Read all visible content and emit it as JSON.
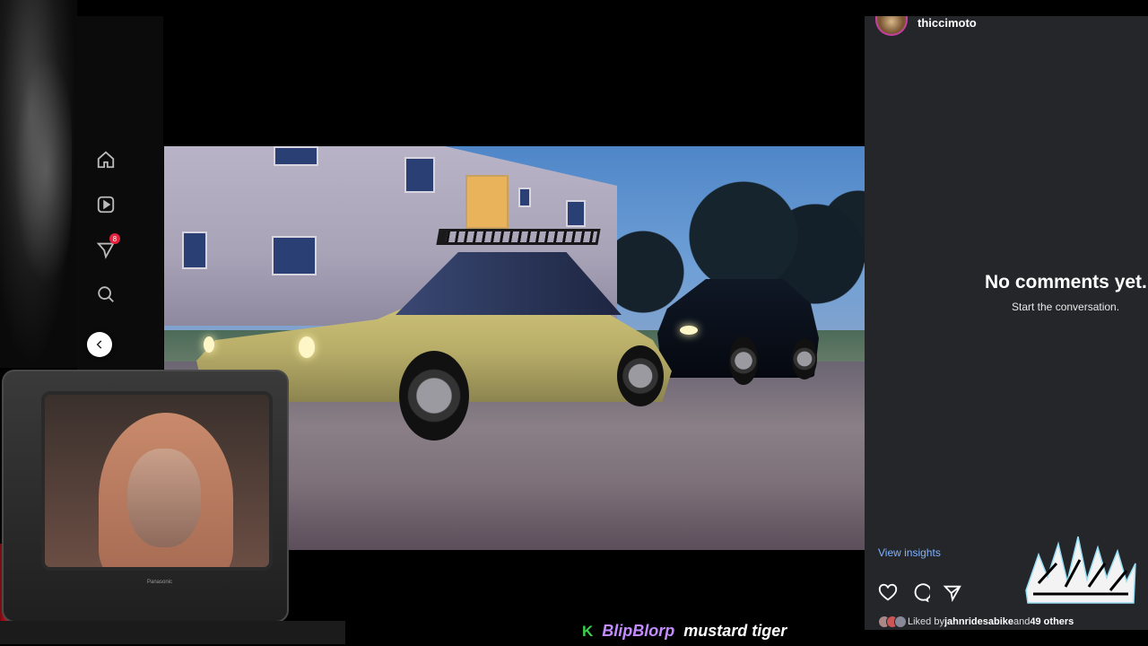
{
  "post": {
    "username": "thiccimoto",
    "photo_alt": "Photo by thiccimoto"
  },
  "nav": {
    "notifications_badge": "8",
    "icons": [
      "home-icon",
      "reels-icon",
      "direct-icon",
      "search-icon"
    ]
  },
  "comments": {
    "empty_title": "No comments yet.",
    "empty_subtitle": "Start the conversation."
  },
  "actions": {
    "view_insights": "View insights",
    "liked_by_prefix": "Liked by ",
    "liked_by_user": "jahnridesabike",
    "liked_by_and": " and ",
    "liked_by_others": "49 others"
  },
  "webcam": {
    "tv_brand": "Panasonic"
  },
  "chat": {
    "badge": "K",
    "user": "BlipBlorp",
    "message": "mustard tiger"
  },
  "colors": {
    "panel_bg": "#25262a",
    "link": "#7fb2ff",
    "chat_user": "#c28cff",
    "badge_red": "#e3223d"
  }
}
